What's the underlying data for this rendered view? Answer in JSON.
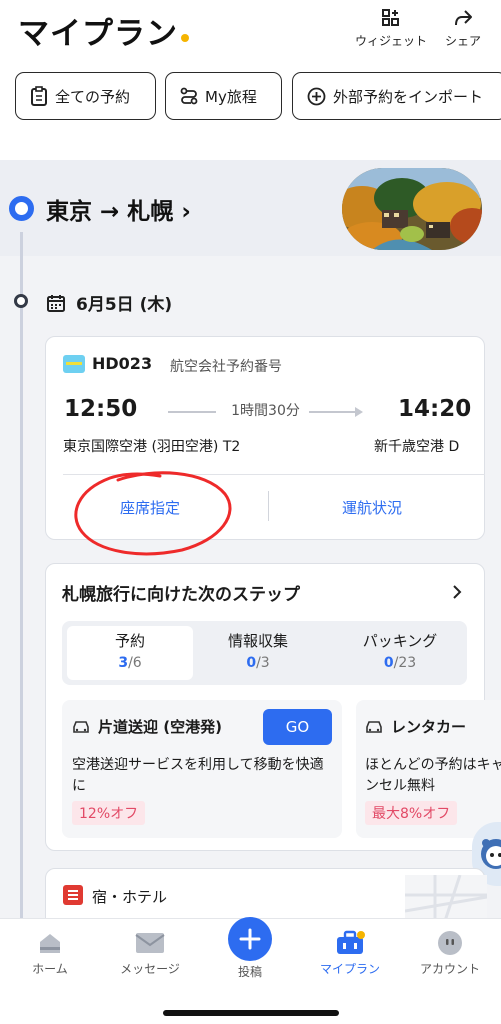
{
  "header": {
    "title": "マイプラン",
    "widget_label": "ウィジェット",
    "share_label": "シェア"
  },
  "filters": {
    "all_bookings": "全ての予約",
    "my_itinerary": "My旅程",
    "import_external": "外部予約をインポート"
  },
  "trip": {
    "route": "東京 → 札幌",
    "date": "6月5日 (木)"
  },
  "flight": {
    "number": "HD023",
    "ref_label": "航空会社予約番号",
    "dep_time": "12:50",
    "duration": "1時間30分",
    "arr_time": "14:20",
    "dep_airport": "東京国際空港 (羽田空港) T2",
    "arr_airport": "新千歳空港 D",
    "seat_link": "座席指定",
    "status_link": "運航状況"
  },
  "steps": {
    "title": "札幌旅行に向けた次のステップ",
    "tabs": [
      {
        "label": "予約",
        "done": "3",
        "total": "/6"
      },
      {
        "label": "情報収集",
        "done": "0",
        "total": "/3"
      },
      {
        "label": "パッキング",
        "done": "0",
        "total": "/23"
      }
    ],
    "services": [
      {
        "name": "片道送迎 (空港発)",
        "action": "GO",
        "desc": "空港送迎サービスを利用して移動を快適に",
        "badge": "12%オフ"
      },
      {
        "name": "レンタカー",
        "desc": "ほとんどの予約はキャンセル無料",
        "badge": "最大8%オフ"
      }
    ]
  },
  "hotel": {
    "label": "宿・ホテル"
  },
  "nav": {
    "home": "ホーム",
    "messages": "メッセージ",
    "post": "投稿",
    "myplan": "マイプラン",
    "account": "アカウント"
  },
  "colors": {
    "accent": "#2d6cf0",
    "title_dot": "#f5b400",
    "discount": "#e24a66",
    "annotation_circle": "#ee2a2a"
  }
}
